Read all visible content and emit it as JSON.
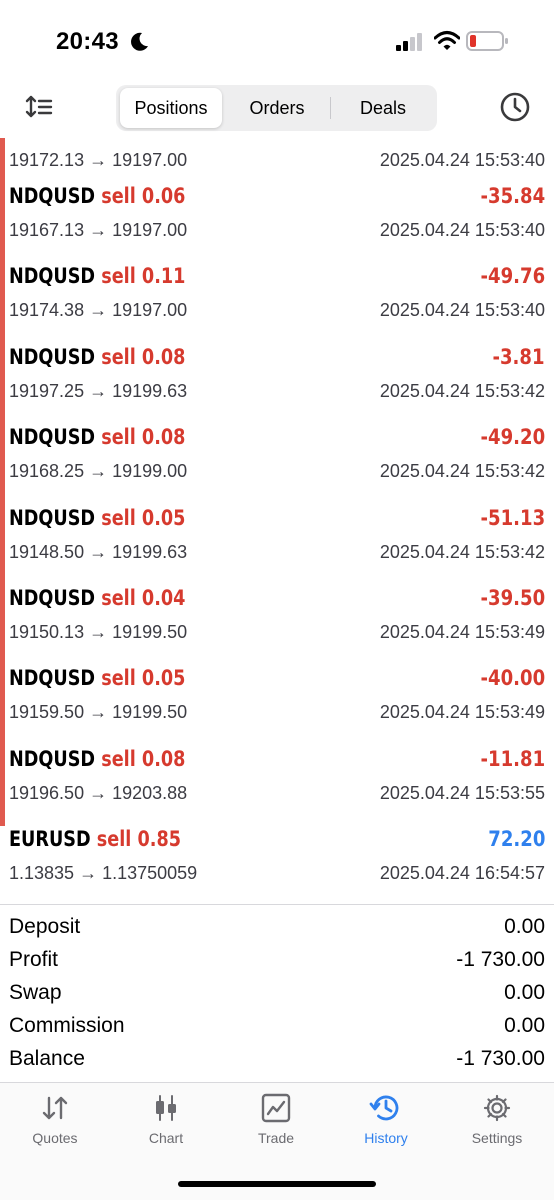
{
  "status": {
    "time": "20:43"
  },
  "segments": {
    "positions": "Positions",
    "orders": "Orders",
    "deals": "Deals"
  },
  "deals": [
    {
      "prices": "19172.13 → 19197.00",
      "time": "2025.04.24 15:53:40"
    },
    {
      "symbol": "NDQUSD",
      "side": "sell 0.06",
      "profit": "-35.84",
      "prices": "19167.13 → 19197.00",
      "time": "2025.04.24 15:53:40"
    },
    {
      "symbol": "NDQUSD",
      "side": "sell 0.11",
      "profit": "-49.76",
      "prices": "19174.38 → 19197.00",
      "time": "2025.04.24 15:53:40"
    },
    {
      "symbol": "NDQUSD",
      "side": "sell 0.08",
      "profit": "-3.81",
      "prices": "19197.25 → 19199.63",
      "time": "2025.04.24 15:53:42"
    },
    {
      "symbol": "NDQUSD",
      "side": "sell 0.08",
      "profit": "-49.20",
      "prices": "19168.25 → 19199.00",
      "time": "2025.04.24 15:53:42"
    },
    {
      "symbol": "NDQUSD",
      "side": "sell 0.05",
      "profit": "-51.13",
      "prices": "19148.50 → 19199.63",
      "time": "2025.04.24 15:53:42"
    },
    {
      "symbol": "NDQUSD",
      "side": "sell 0.04",
      "profit": "-39.50",
      "prices": "19150.13 → 19199.50",
      "time": "2025.04.24 15:53:49"
    },
    {
      "symbol": "NDQUSD",
      "side": "sell 0.05",
      "profit": "-40.00",
      "prices": "19159.50 → 19199.50",
      "time": "2025.04.24 15:53:49"
    },
    {
      "symbol": "NDQUSD",
      "side": "sell 0.08",
      "profit": "-11.81",
      "prices": "19196.50 → 19203.88",
      "time": "2025.04.24 15:53:55"
    },
    {
      "symbol": "EURUSD",
      "side": "sell 0.85",
      "profit": "72.20",
      "prices": "1.13835 → 1.13750059",
      "time": "2025.04.24 16:54:57"
    }
  ],
  "summary": [
    {
      "label": "Deposit",
      "value": "0.00"
    },
    {
      "label": "Profit",
      "value": "-1 730.00"
    },
    {
      "label": "Swap",
      "value": "0.00"
    },
    {
      "label": "Commission",
      "value": "0.00"
    },
    {
      "label": "Balance",
      "value": "-1 730.00"
    }
  ],
  "tabs": {
    "quotes": "Quotes",
    "chart": "Chart",
    "trade": "Trade",
    "history": "History",
    "settings": "Settings"
  },
  "colors": {
    "loss": "#d63a2e",
    "gain": "#2f80ed",
    "accent": "#2f80ed",
    "side_bar": "#e05a4f"
  }
}
